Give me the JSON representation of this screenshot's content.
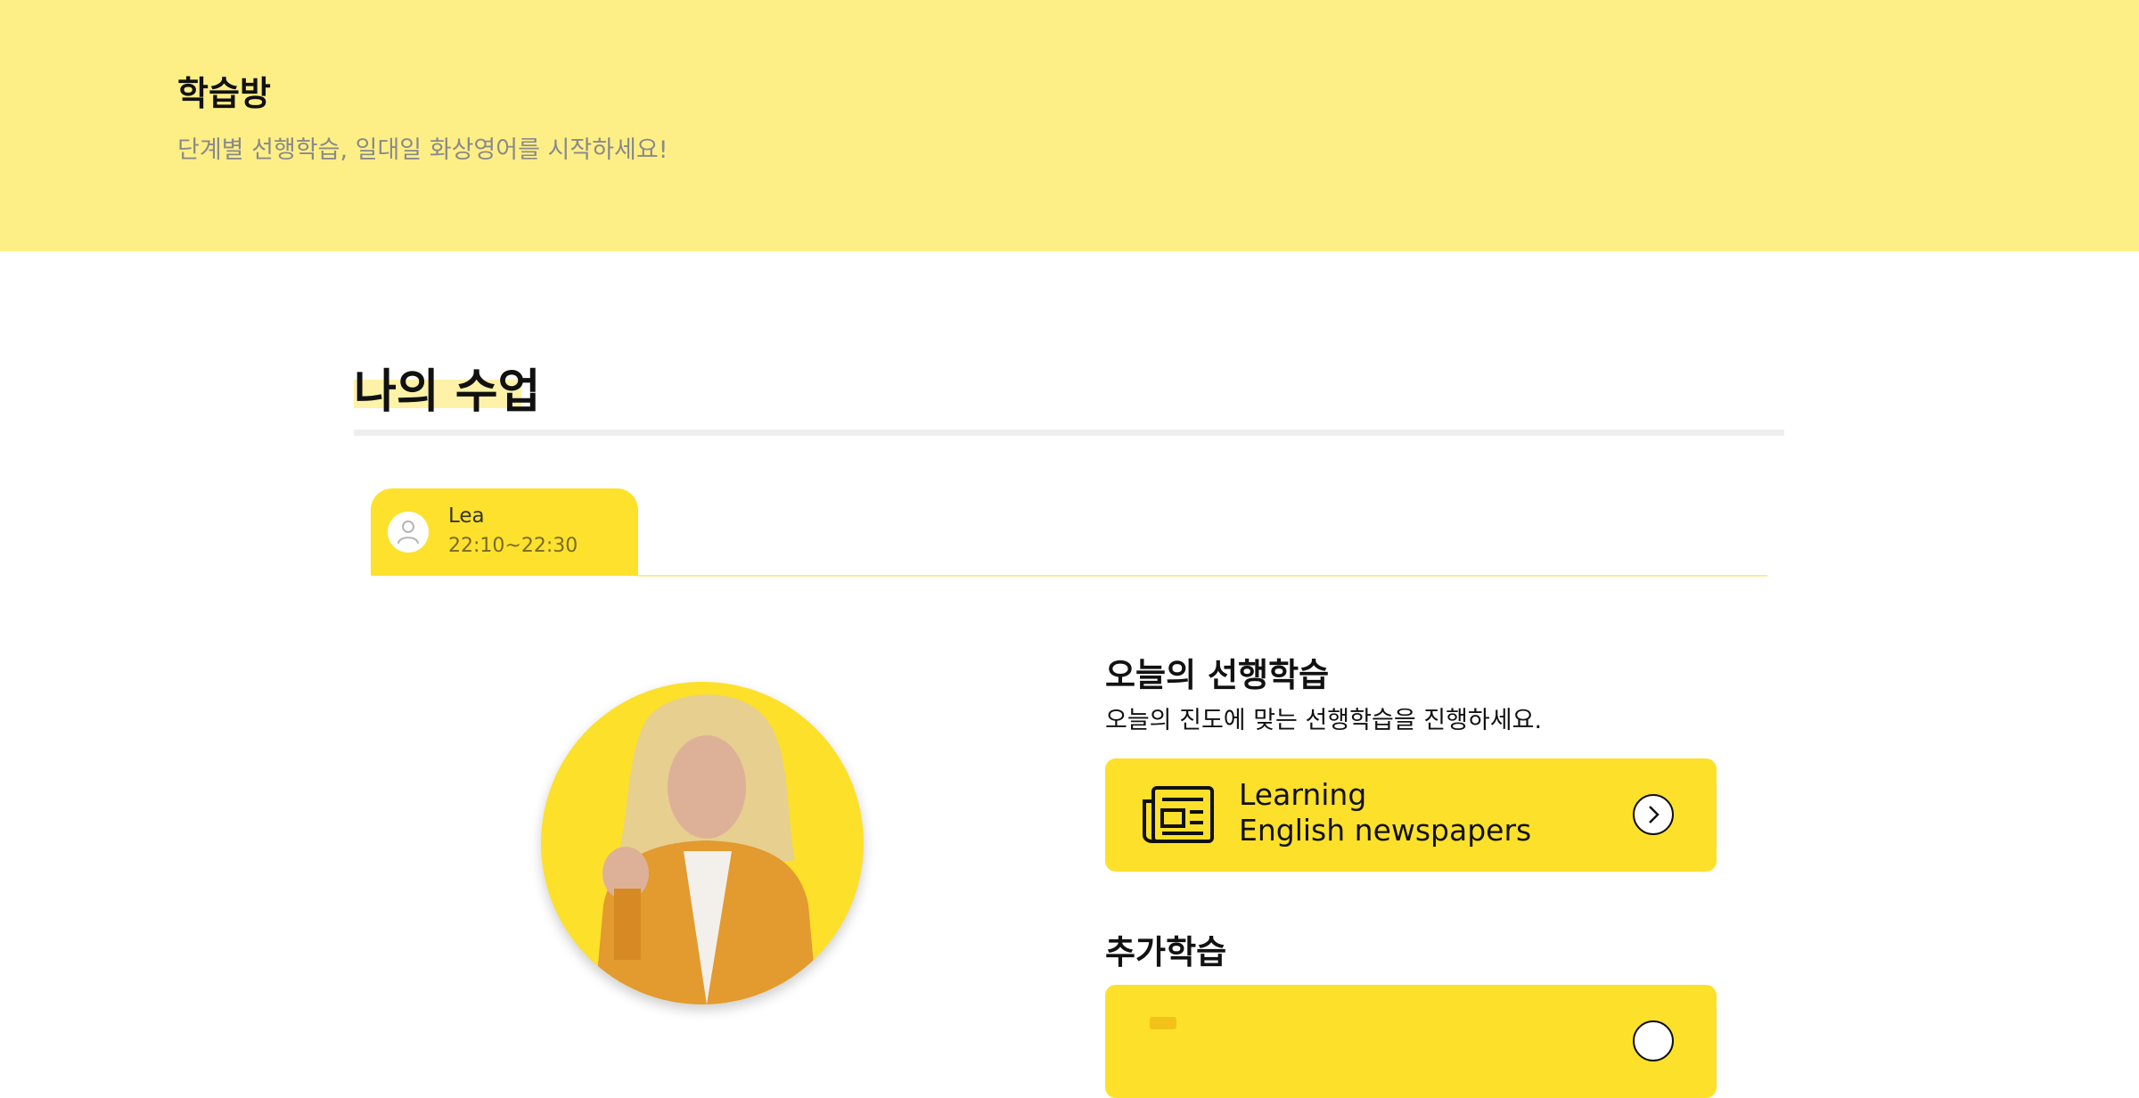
{
  "hero": {
    "title": "학습방",
    "subtitle": "단계별 선행학습, 일대일 화상영어를 시작하세요!"
  },
  "section": {
    "title": "나의 수업"
  },
  "class_tab": {
    "teacher": "Lea",
    "time": "22:10~22:30",
    "avatar_icon": "user-icon"
  },
  "today": {
    "title": "오늘의 선행학습",
    "description": "오늘의 진도에 맞는 선행학습을 진행하세요.",
    "card": {
      "line1": "Learning",
      "line2": "English newspapers",
      "icon": "newspaper-icon",
      "arrow_icon": "chevron-right-icon"
    }
  },
  "extra": {
    "title": "추가학습"
  },
  "colors": {
    "hero_bg": "#fdef86",
    "accent": "#fde02a"
  }
}
